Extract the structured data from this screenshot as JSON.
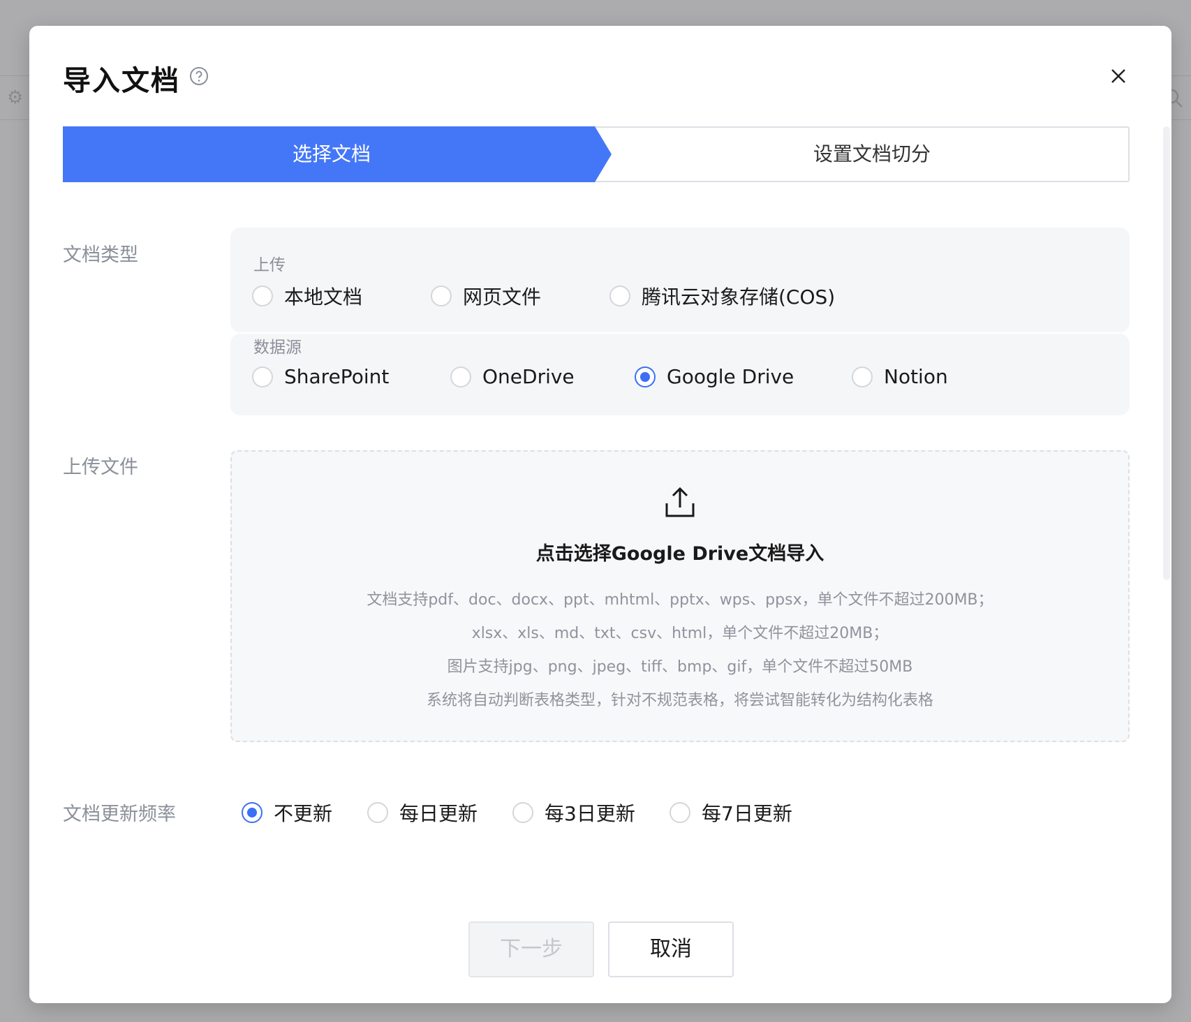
{
  "dialog": {
    "title": "导入文档"
  },
  "steps": [
    {
      "label": "选择文档",
      "active": true
    },
    {
      "label": "设置文档切分",
      "active": false
    }
  ],
  "doc_type": {
    "label": "文档类型",
    "upload_group": {
      "title": "上传",
      "options": [
        {
          "label": "本地文档",
          "checked": false
        },
        {
          "label": "网页文件",
          "checked": false
        },
        {
          "label": "腾讯云对象存储(COS)",
          "checked": false
        }
      ]
    },
    "source_group": {
      "title": "数据源",
      "options": [
        {
          "label": "SharePoint",
          "checked": false
        },
        {
          "label": "OneDrive",
          "checked": false
        },
        {
          "label": "Google Drive",
          "checked": true
        },
        {
          "label": "Notion",
          "checked": false
        }
      ]
    }
  },
  "upload_file": {
    "label": "上传文件",
    "title": "点击选择Google Drive文档导入",
    "notes": [
      "文档支持pdf、doc、docx、ppt、mhtml、pptx、wps、ppsx，单个文件不超过200MB；",
      "xlsx、xls、md、txt、csv、html，单个文件不超过20MB；",
      "图片支持jpg、png、jpeg、tiff、bmp、gif，单个文件不超过50MB",
      "系统将自动判断表格类型，针对不规范表格，将尝试智能转化为结构化表格"
    ]
  },
  "update_freq": {
    "label": "文档更新频率",
    "options": [
      {
        "label": "不更新",
        "checked": true
      },
      {
        "label": "每日更新",
        "checked": false
      },
      {
        "label": "每3日更新",
        "checked": false
      },
      {
        "label": "每7日更新",
        "checked": false
      }
    ]
  },
  "footer": {
    "next_label": "下一步",
    "cancel_label": "取消"
  },
  "colors": {
    "primary": "#3c6ff5",
    "panel_bg": "#f5f6f8"
  }
}
